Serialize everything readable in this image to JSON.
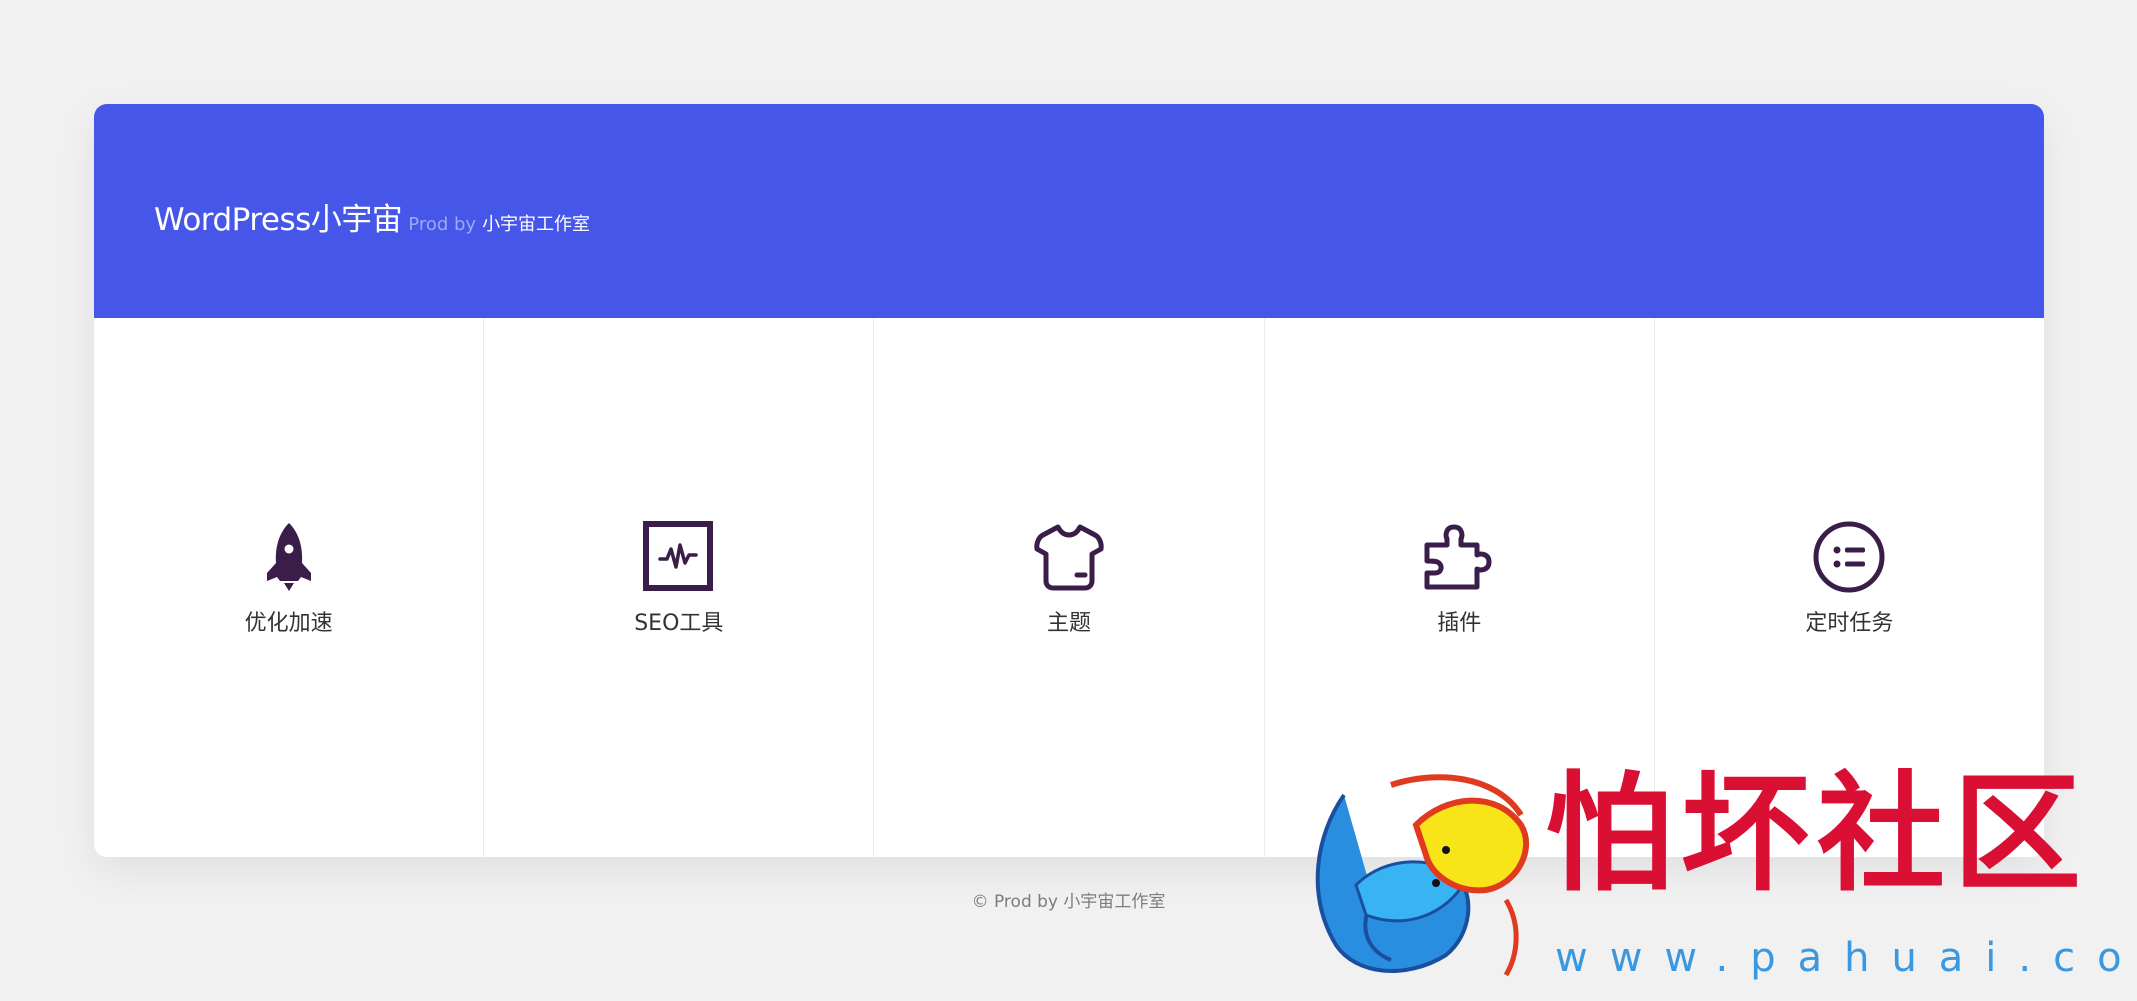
{
  "header": {
    "site_name": "WordPress小宇宙",
    "prod_by": "Prod by",
    "studio": "小宇宙工作室"
  },
  "colors": {
    "header_bg": "#4656e8",
    "icon_color": "#3a1d49",
    "page_bg": "#f1f1f2",
    "watermark_red": "#d90f34",
    "watermark_blue": "#3a98e0"
  },
  "menu": [
    {
      "label": "优化加速",
      "icon": "rocket-icon"
    },
    {
      "label": "SEO工具",
      "icon": "pulse-chart-icon"
    },
    {
      "label": "主题",
      "icon": "tshirt-icon"
    },
    {
      "label": "插件",
      "icon": "puzzle-icon"
    },
    {
      "label": "定时任务",
      "icon": "list-circle-icon"
    }
  ],
  "footer": {
    "text": "© Prod by 小宇宙工作室"
  },
  "watermark": {
    "title": "怕坏社区",
    "url": "www.pahuai.com"
  }
}
